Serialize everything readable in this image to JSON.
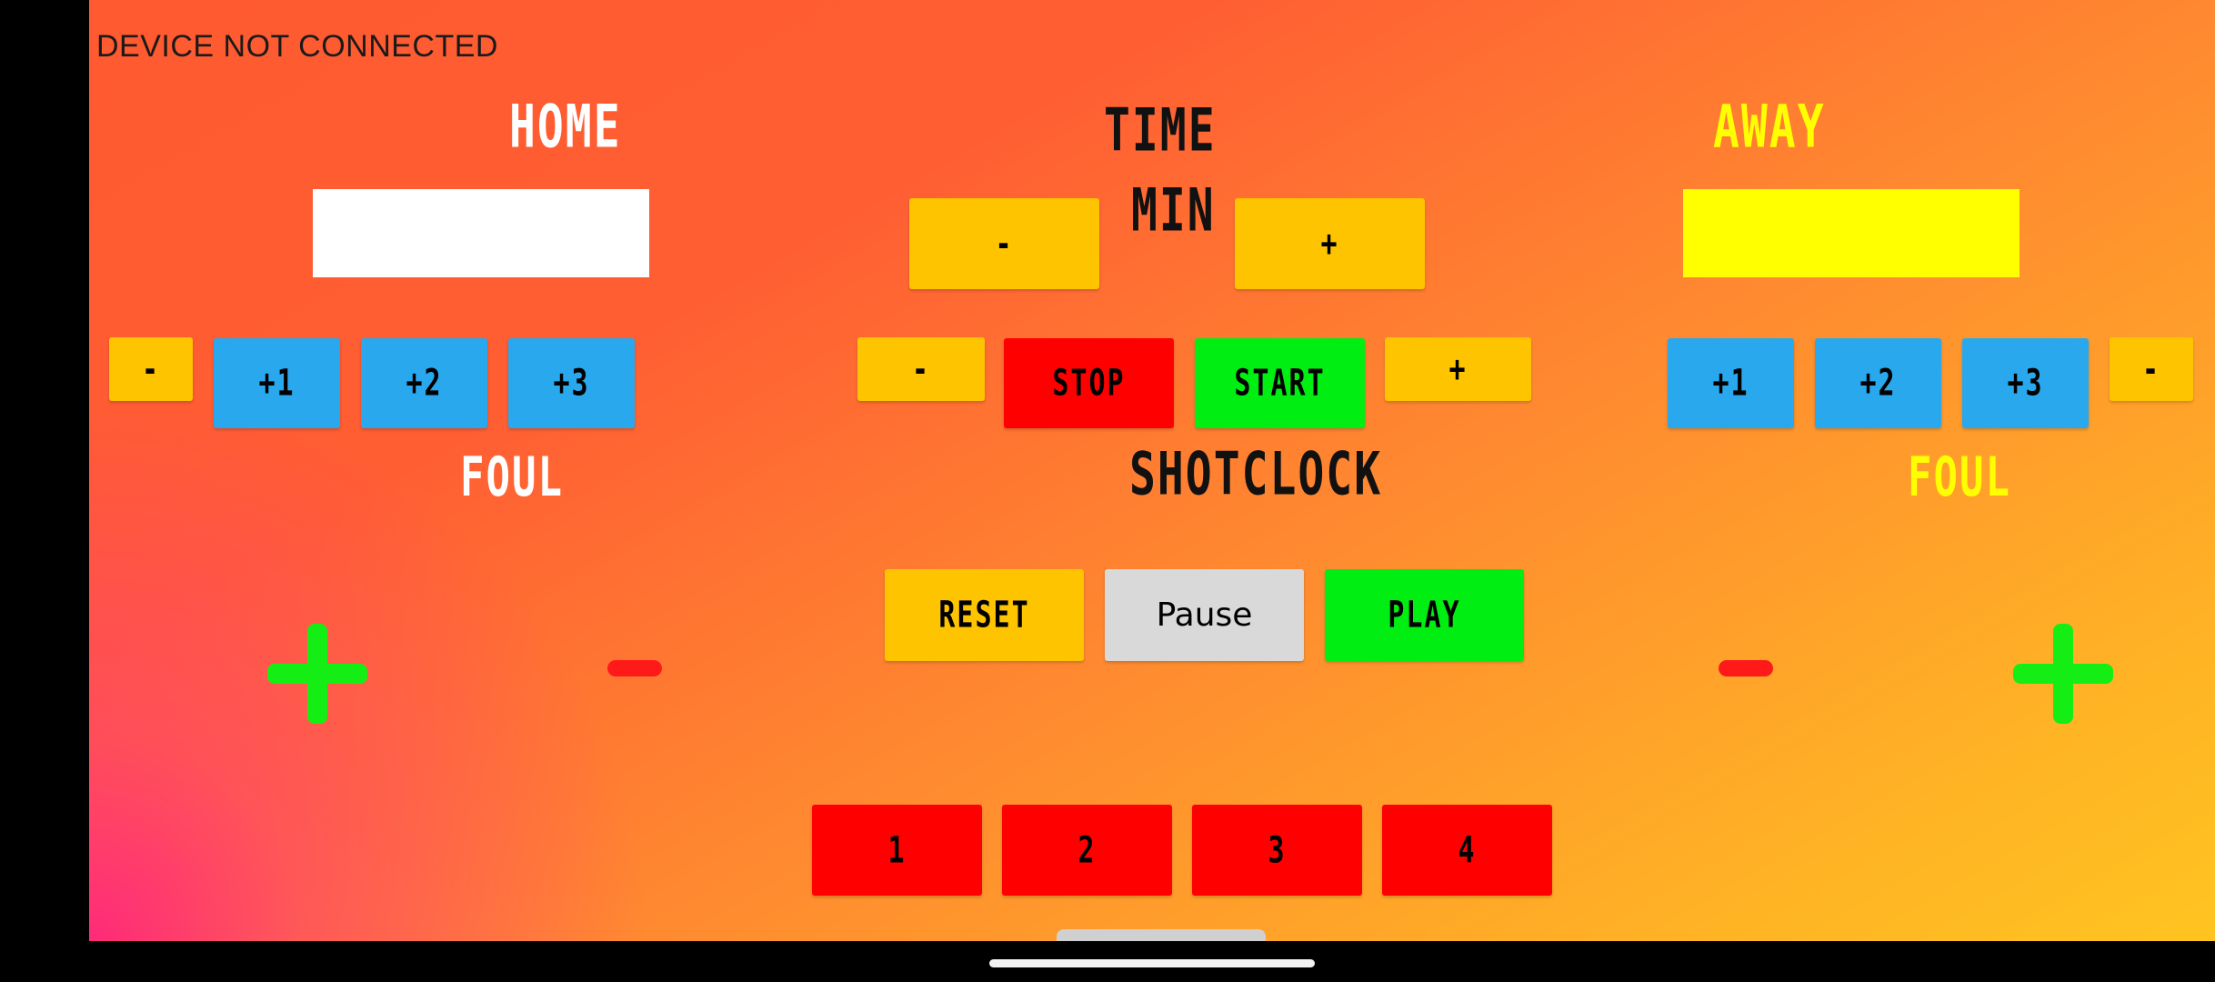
{
  "status": "DEVICE NOT CONNECTED",
  "home": {
    "label": "HOME",
    "label_color": "#ffffff",
    "field_color": "#ffffff",
    "foul_minus": "-",
    "plus1": "+1",
    "plus2": "+2",
    "plus3": "+3",
    "foul_label": "FOUL"
  },
  "away": {
    "label": "AWAY",
    "label_color": "#ffff00",
    "field_color": "#ffff00",
    "plus1": "+1",
    "plus2": "+2",
    "plus3": "+3",
    "foul_minus": "-",
    "foul_label": "FOUL"
  },
  "time": {
    "label": "TIME",
    "unit": "MIN",
    "minus": "-",
    "plus": "+"
  },
  "timer_controls": {
    "minus": "-",
    "stop": "STOP",
    "start": "START",
    "plus": "+"
  },
  "shotclock": {
    "label": "SHOTCLOCK",
    "reset": "RESET",
    "pause": "Pause",
    "play": "PLAY"
  },
  "periods": [
    "1",
    "2",
    "3",
    "4"
  ],
  "icons": {
    "home_add": "plus-icon",
    "home_remove": "minus-icon",
    "away_remove": "minus-icon",
    "away_add": "plus-icon"
  },
  "colors": {
    "yellow_button": "#ffc400",
    "blue_button": "#2aa8ee",
    "red_button": "#ff0000",
    "green_button": "#00ee12",
    "grey_button": "#d9d9d9"
  }
}
